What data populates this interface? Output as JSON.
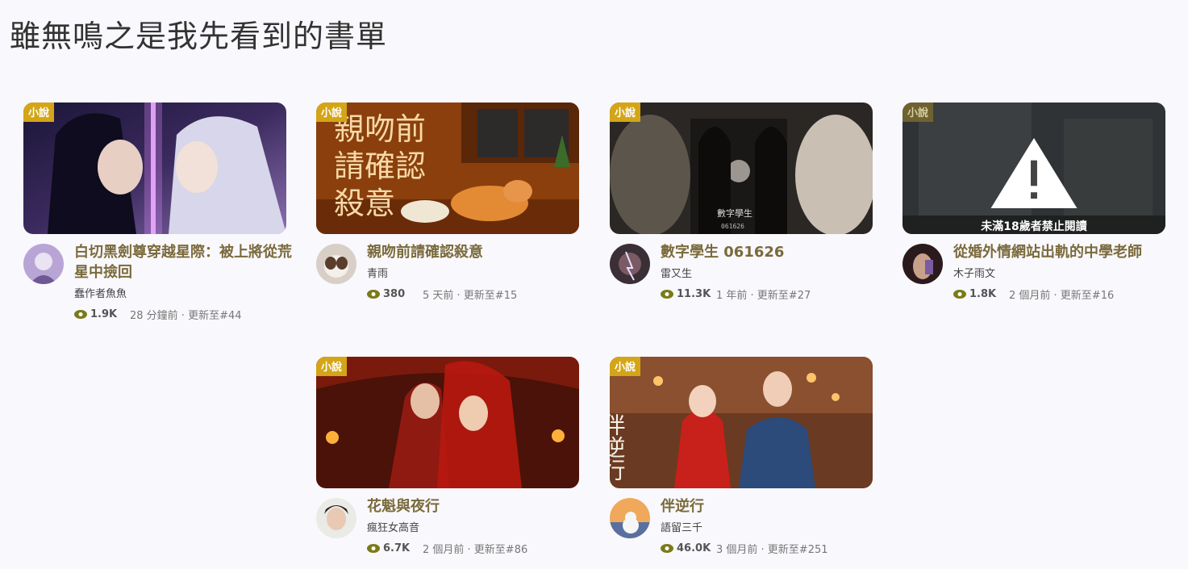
{
  "page": {
    "title": "雖無鳴之是我先看到的書單"
  },
  "badge_label": "小說",
  "warning_text": "未滿18歲者禁止閱讀",
  "cover_texts": {
    "book2": [
      "親吻前",
      "請確認",
      "殺意"
    ],
    "book3": [
      "數字學生",
      "061626"
    ],
    "book6": "伴逆行"
  },
  "books": [
    {
      "title": "白切黑劍尊穿越星際：被上將從荒星中撿回",
      "author": "蠢作者魚魚",
      "views": "1.9K",
      "updated": "28 分鐘前 · 更新至#44"
    },
    {
      "title": "親吻前請確認殺意",
      "author": "青雨",
      "views": "380",
      "updated": "5 天前 · 更新至#15"
    },
    {
      "title": "數字學生 061626",
      "author": "雷又生",
      "views": "11.3K",
      "updated": "1 年前 · 更新至#27"
    },
    {
      "title": "從婚外情網站出軌的中學老師",
      "author": "木子雨文",
      "views": "1.8K",
      "updated": "2 個月前 · 更新至#16"
    },
    {
      "title": "花魁與夜行",
      "author": "瘋狂女高音",
      "views": "6.7K",
      "updated": "2 個月前 · 更新至#86"
    },
    {
      "title": "伴逆行",
      "author": "語留三千",
      "views": "46.0K",
      "updated": "3 個月前 · 更新至#251"
    }
  ],
  "colors": {
    "accent": "#7a6a3c",
    "badge": "#d4a517",
    "eye": "#7a7a1a"
  }
}
